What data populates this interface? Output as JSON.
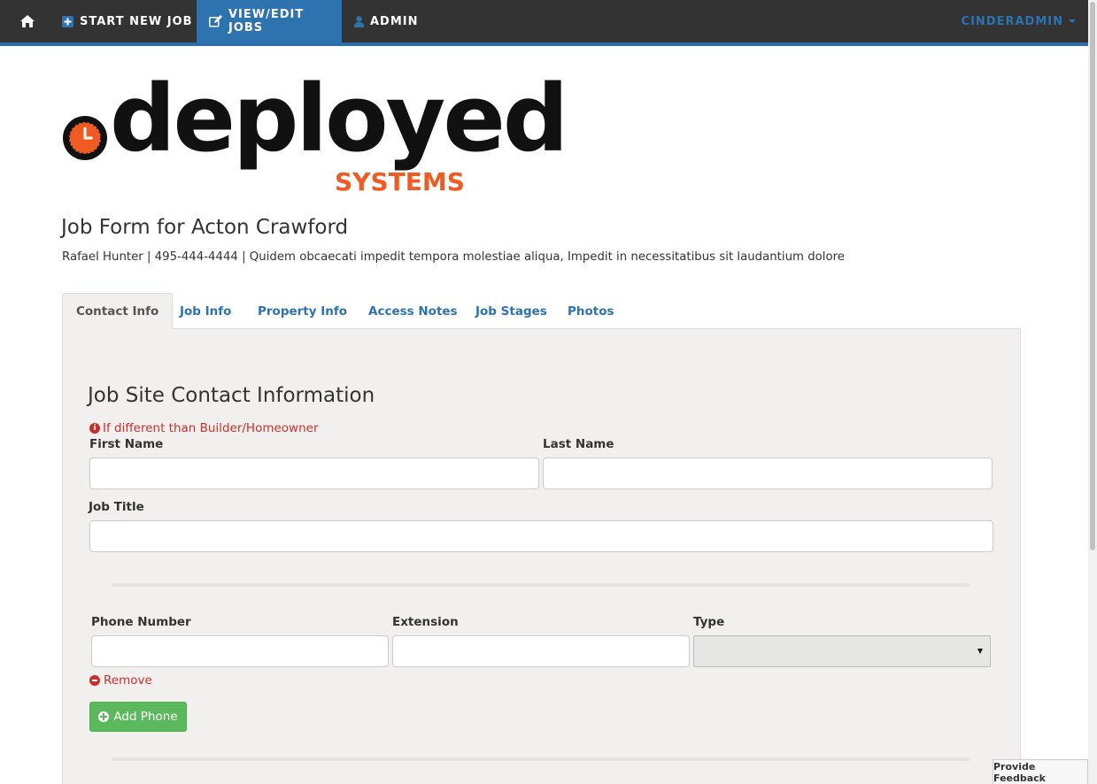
{
  "nav": {
    "home_icon": "home-icon",
    "start_label": "START NEW JOB",
    "view_label": "VIEW/EDIT JOBS",
    "admin_label": "ADMIN",
    "user_label": "CINDERADMIN",
    "active_color": "#2d73b0",
    "bg_color": "#333333"
  },
  "logo": {
    "word": "deployed",
    "sub": "SYSTEMS",
    "accent_color": "#f05a23"
  },
  "page": {
    "title": "Job Form for Acton Crawford",
    "subtitle": "Rafael Hunter | 495-444-4444 | Quidem obcaecati impedit tempora molestiae aliqua, Impedit in necessitatibus sit laudantium dolore"
  },
  "tabs": [
    {
      "label": "Contact Info",
      "active": true
    },
    {
      "label": "Job Info",
      "active": false
    },
    {
      "label": "Property Info",
      "active": false
    },
    {
      "label": "Access Notes",
      "active": false
    },
    {
      "label": "Job Stages",
      "active": false
    },
    {
      "label": "Photos",
      "active": false
    }
  ],
  "form": {
    "section_title": "Job Site Contact Information",
    "notice": "If different than Builder/Homeowner",
    "first_name_label": "First Name",
    "first_name_value": "",
    "last_name_label": "Last Name",
    "last_name_value": "",
    "job_title_label": "Job Title",
    "job_title_value": "",
    "phone_label": "Phone Number",
    "phone_value": "",
    "extension_label": "Extension",
    "extension_value": "",
    "type_label": "Type",
    "type_value": "",
    "remove_label": "Remove",
    "add_phone_label": "Add Phone"
  },
  "feedback_label": "Provide Feedback"
}
